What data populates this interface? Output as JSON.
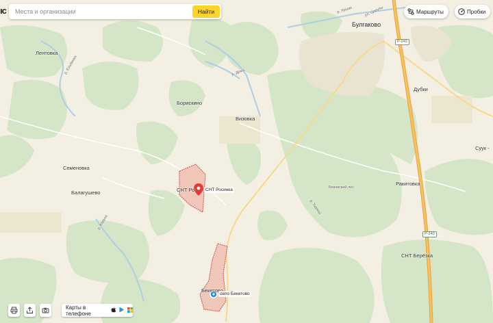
{
  "header": {
    "brand_fragment": "ıс",
    "search": {
      "placeholder": "Места и организации",
      "button_label": "Найти"
    },
    "routes_label": "Маршруты",
    "traffic_label": "Пробки"
  },
  "footer": {
    "apps_label": "Карты в телефоне"
  },
  "colors": {
    "land": "#f3efe2",
    "forest": "#d4e6c7",
    "area_fill": "#f0c6b8",
    "area_stroke": "#c0504d",
    "highway": "#f2a742",
    "road": "#f6da8a",
    "river": "#aecfe2",
    "pin_red": "#e53935",
    "pin_blue": "#1e88e5"
  },
  "labels": {
    "bulgakovo": "Булгаково",
    "lentovka": "Лентовка",
    "boriskino": "Борискино",
    "vizovka": "Визовка",
    "semenovka": "Семеновка",
    "balagushevo": "Балагушево",
    "dubki": "Дубки",
    "rakitovka": "Ракитовка",
    "suuk": "Суук -",
    "snt_ro": "СНТ Ро",
    "snt_rosinka": "СНТ Росинка",
    "snt_berezka": "СНТ Берёзка",
    "beketovo": "Бекетово",
    "selo_beketovo": "село Бекетово",
    "vizovsky_les": "Визовский лес",
    "road_dyoma": "р. Дёма",
    "road_urshak": "р. Уршак",
    "road_elbinka": "р. Ельбинка",
    "road_tyuryush": "р. Тюрюш",
    "road_kidyash": "р. Кидыш",
    "street_tsoruly": "ул. Цорулы",
    "river_ufa": "р. Уршак",
    "road_m5": "Р-240"
  },
  "icons": {
    "search": "search-icon",
    "routes": "route-icon",
    "traffic": "traffic-icon",
    "pin_red": "location-pin-icon",
    "pin_blue": "location-pin-icon",
    "print": "print-icon",
    "share": "share-icon",
    "camera": "camera-icon"
  }
}
